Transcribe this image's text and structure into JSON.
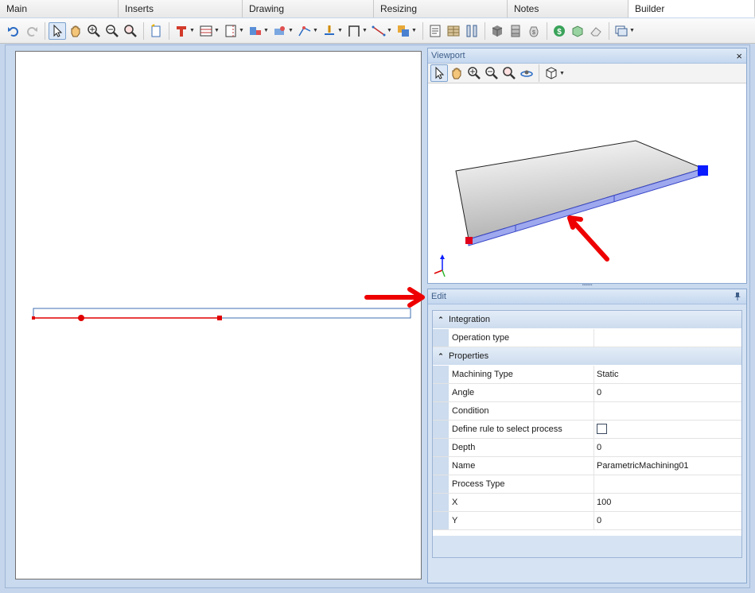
{
  "tabs": [
    {
      "label": "Main",
      "active": false
    },
    {
      "label": "Inserts",
      "active": false
    },
    {
      "label": "Drawing",
      "active": false
    },
    {
      "label": "Resizing",
      "active": false
    },
    {
      "label": "Notes",
      "active": false
    },
    {
      "label": "Builder",
      "active": true
    }
  ],
  "toolbar": {
    "icons": [
      "undo-icon",
      "redo-icon",
      "select-pointer-icon",
      "pan-hand-icon",
      "zoom-in-icon",
      "zoom-out-icon",
      "zoom-extents-icon",
      "new-part-icon",
      "tool-dropdown-icon",
      "layout-dropdown-icon",
      "panel-dropdown-icon",
      "insert-dropdown-icon",
      "machining-dropdown-icon",
      "path-dropdown-icon",
      "drill-dropdown-icon",
      "frame-dropdown-icon",
      "line-dropdown-icon",
      "copy-dropdown-icon",
      "report-icon",
      "material-icon",
      "columns-icon",
      "box-icon",
      "parts-icon",
      "cost-bag-icon",
      "price-icon",
      "refresh-3d-icon",
      "eraser-icon",
      "window-dropdown-icon"
    ]
  },
  "viewport": {
    "title": "Viewport",
    "close_label": "×",
    "tools": [
      "select-pointer-icon",
      "pan-hand-icon",
      "zoom-in-icon",
      "zoom-out-icon",
      "zoom-extents-icon",
      "orbit-icon",
      "view-cube-icon"
    ]
  },
  "edit": {
    "title": "Edit",
    "pin_label": "📌",
    "categories": [
      {
        "label": "Integration",
        "rows": [
          {
            "key": "Operation type",
            "value": ""
          }
        ]
      },
      {
        "label": "Properties",
        "rows": [
          {
            "key": "Machining Type",
            "value": "Static"
          },
          {
            "key": "Angle",
            "value": "0"
          },
          {
            "key": "Condition",
            "value": ""
          },
          {
            "key": "Define rule to select process",
            "value": "",
            "checkbox": true,
            "checked": false
          },
          {
            "key": "Depth",
            "value": "0"
          },
          {
            "key": "Name",
            "value": "ParametricMachining01"
          },
          {
            "key": "Process Type",
            "value": ""
          },
          {
            "key": "X",
            "value": "100"
          },
          {
            "key": "Y",
            "value": "0"
          }
        ]
      }
    ]
  },
  "colors": {
    "accent": "#4a7cc0",
    "machining_line": "#e00000",
    "annotation_arrow": "#ee0000",
    "handle_start": "#e0001b",
    "handle_end": "#0a1cff"
  }
}
